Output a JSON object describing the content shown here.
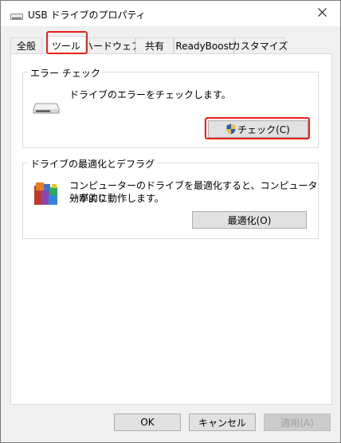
{
  "window": {
    "title": "USB ドライブのプロパティ",
    "close_label": "✕"
  },
  "tabs": [
    {
      "label": "全般",
      "active": false
    },
    {
      "label": "ツール",
      "active": true
    },
    {
      "label": "ハードウェア",
      "active": false
    },
    {
      "label": "共有",
      "active": false
    },
    {
      "label": "ReadyBoost",
      "active": false
    },
    {
      "label": "カスタマイズ",
      "active": false
    }
  ],
  "error_check": {
    "title": "エラー チェック",
    "description": "ドライブのエラーをチェックします。",
    "button_label": "チェック(C)"
  },
  "optimize": {
    "title": "ドライブの最適化とデフラグ",
    "description_line1": "コンピューターのドライブを最適化すると、コンピューターがより",
    "description_line2": "効率的に動作します。",
    "button_label": "最適化(O)"
  },
  "footer": {
    "ok_label": "OK",
    "cancel_label": "キャンセル",
    "apply_label": "適用(A)"
  },
  "colors": {
    "highlight": "#e8201c",
    "uac_shield_blue": "#1f5fbf",
    "uac_shield_yellow": "#f2c230"
  },
  "icons": {
    "title": "usb-drive-icon",
    "error_check": "drive-icon",
    "optimize": "defrag-icon",
    "shield": "uac-shield-icon"
  }
}
